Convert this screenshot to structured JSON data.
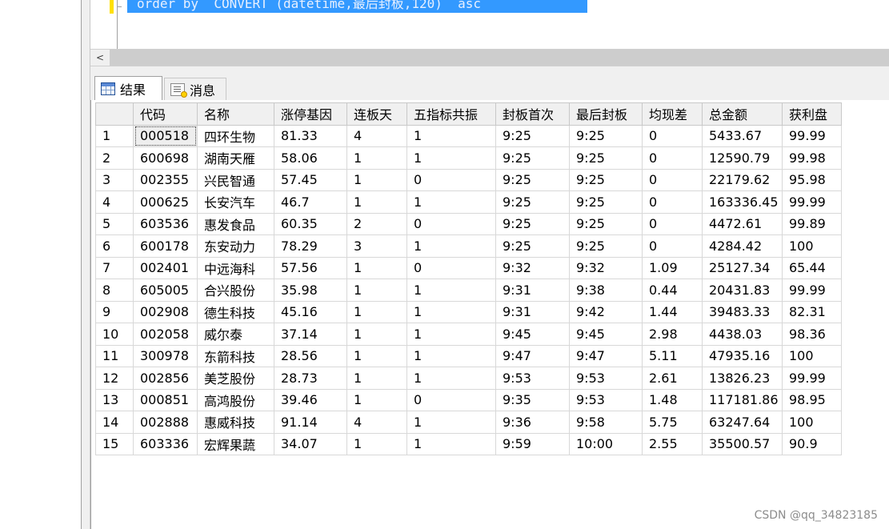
{
  "editor": {
    "sql_line": "order by  CONVERT (datetime,最后封板,120)  asc"
  },
  "scrollbar": {
    "left_arrow": "<"
  },
  "tabs": [
    {
      "label": "结果",
      "icon": "grid-icon",
      "active": true
    },
    {
      "label": "消息",
      "icon": "message-icon",
      "active": false
    }
  ],
  "table": {
    "columns": [
      "代码",
      "名称",
      "涨停基因",
      "连板天",
      "五指标共振",
      "封板首次",
      "最后封板",
      "均现差",
      "总金额",
      "获利盘"
    ],
    "rows": [
      [
        "1",
        "000518",
        "四环生物",
        "81.33",
        "4",
        "1",
        "9:25",
        "9:25",
        "0",
        "5433.67",
        "99.99"
      ],
      [
        "2",
        "600698",
        "湖南天雁",
        "58.06",
        "1",
        "1",
        "9:25",
        "9:25",
        "0",
        "12590.79",
        "99.98"
      ],
      [
        "3",
        "002355",
        "兴民智通",
        "57.45",
        "1",
        "0",
        "9:25",
        "9:25",
        "0",
        "22179.62",
        "95.98"
      ],
      [
        "4",
        "000625",
        "长安汽车",
        "46.7",
        "1",
        "1",
        "9:25",
        "9:25",
        "0",
        "163336.45",
        "99.99"
      ],
      [
        "5",
        "603536",
        "惠发食品",
        "60.35",
        "2",
        "0",
        "9:25",
        "9:25",
        "0",
        "4472.61",
        "99.89"
      ],
      [
        "6",
        "600178",
        "东安动力",
        "78.29",
        "3",
        "1",
        "9:25",
        "9:25",
        "0",
        "4284.42",
        "100"
      ],
      [
        "7",
        "002401",
        "中远海科",
        "57.56",
        "1",
        "0",
        "9:32",
        "9:32",
        "1.09",
        "25127.34",
        "65.44"
      ],
      [
        "8",
        "605005",
        "合兴股份",
        "35.98",
        "1",
        "1",
        "9:31",
        "9:38",
        "0.44",
        "20431.83",
        "99.99"
      ],
      [
        "9",
        "002908",
        "德生科技",
        "45.16",
        "1",
        "1",
        "9:31",
        "9:42",
        "1.44",
        "39483.33",
        "82.31"
      ],
      [
        "10",
        "002058",
        "威尔泰",
        "37.14",
        "1",
        "1",
        "9:45",
        "9:45",
        "2.98",
        "4438.03",
        "98.36"
      ],
      [
        "11",
        "300978",
        "东箭科技",
        "28.56",
        "1",
        "1",
        "9:47",
        "9:47",
        "5.11",
        "47935.16",
        "100"
      ],
      [
        "12",
        "002856",
        "美芝股份",
        "28.73",
        "1",
        "1",
        "9:53",
        "9:53",
        "2.61",
        "13826.23",
        "99.99"
      ],
      [
        "13",
        "000851",
        "高鸿股份",
        "39.46",
        "1",
        "0",
        "9:35",
        "9:53",
        "1.48",
        "117181.86",
        "98.95"
      ],
      [
        "14",
        "002888",
        "惠威科技",
        "91.14",
        "4",
        "1",
        "9:36",
        "9:58",
        "5.75",
        "63247.64",
        "100"
      ],
      [
        "15",
        "603336",
        "宏辉果蔬",
        "34.07",
        "1",
        "1",
        "9:59",
        "10:00",
        "2.55",
        "35500.57",
        "90.9"
      ]
    ]
  },
  "watermark": "CSDN @qq_34823185"
}
